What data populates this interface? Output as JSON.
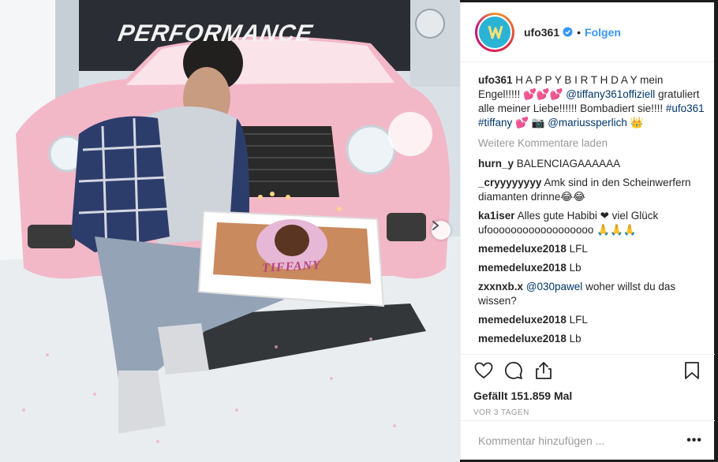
{
  "post": {
    "username": "ufo361",
    "follow_label": "Folgen",
    "dot": "•",
    "caption": {
      "user": "ufo361",
      "text_1": "H A P P Y B I R T H D A Y mein Engel!!!!! ",
      "hearts_1": "💕💕💕",
      "mention_1": "@tiffany361offiziell",
      "text_2": " gratuliert alle meiner Liebe!!!!!! Bombadiert sie!!!! ",
      "hashtag_1": "#ufo361",
      "hashtag_2": "#tiffany",
      "emoji_2": "💕 📷",
      "mention_2": "@mariussperlich",
      "emoji_3": "👑"
    },
    "load_more": "Weitere Kommentare laden",
    "comments": [
      {
        "user": "hurn_y",
        "text": "BALENCIAGAAAAAA"
      },
      {
        "user": "_cryyyyyyyy",
        "text": "Amk sind in den Scheinwerfern diamanten drinne😂😂"
      },
      {
        "user": "ka1iser",
        "text": "Alles gute Habibi ❤ viel Glück ufoooooooooooooooooo 🙏🙏🙏"
      },
      {
        "user": "memedeluxe2018",
        "text": "LFL"
      },
      {
        "user": "memedeluxe2018",
        "text": "Lb"
      },
      {
        "user": "zxxnxb.x",
        "mention": "@030pawel",
        "text": " woher willst du das wissen?"
      },
      {
        "user": "memedeluxe2018",
        "text": "LFL"
      },
      {
        "user": "memedeluxe2018",
        "text": "Lb"
      }
    ],
    "likes": "Gefällt 151.859 Mal",
    "time": "VOR 3 TAGEN",
    "comment_placeholder": "Kommentar hinzufügen ...",
    "options": "•••"
  },
  "photo": {
    "brand_banner": "PERFORMANCE",
    "cake_name": "TIFFANY"
  },
  "colors": {
    "accent": "#3897f0",
    "link": "#003569",
    "muted": "#999999",
    "car": "#f3b8c8"
  },
  "icons": [
    "heart-icon",
    "comment-icon",
    "share-icon",
    "bookmark-icon",
    "verified-icon",
    "chevron-right-icon"
  ]
}
